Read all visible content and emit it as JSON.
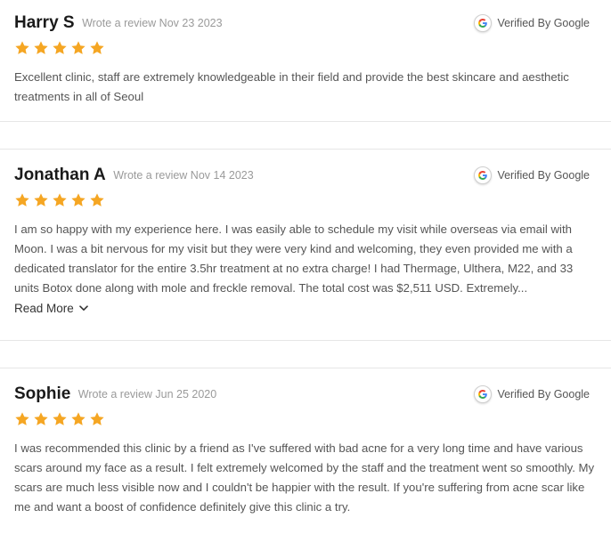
{
  "accent_star_color": "#f5a623",
  "icons": {
    "verified": "google-g-icon",
    "star": "star-icon",
    "read_more": "chevron-down-icon"
  },
  "reviews": [
    {
      "name": "Harry S",
      "meta": "Wrote a review Nov 23 2023",
      "verified_label": "Verified By",
      "verified_source": "Google",
      "rating": 5,
      "text": "Excellent clinic, staff are extremely knowledgeable in their field and provide the best skincare and aesthetic treatments in all of Seoul"
    },
    {
      "name": "Jonathan A",
      "meta": "Wrote a review Nov 14 2023",
      "verified_label": "Verified By",
      "verified_source": "Google",
      "rating": 5,
      "text": "I am so happy with my experience here. I was easily able to schedule my visit while overseas via email with Moon. I was a bit nervous for my visit but they were very kind and welcoming, they even provided me with a dedicated translator for the entire 3.5hr treatment at no extra charge! I had Thermage, Ulthera, M22, and 33 units Botox done along with mole and freckle removal. The total cost was $2,511 USD. Extremely...",
      "read_more": "Read More"
    },
    {
      "name": "Sophie",
      "meta": "Wrote a review Jun 25 2020",
      "verified_label": "Verified By",
      "verified_source": "Google",
      "rating": 5,
      "text": "I was recommended this clinic by a friend as I've suffered with bad acne for a very long time and have various scars around my face as a result. I felt extremely welcomed by the staff and the treatment went so smoothly. My scars are much less visible now and I couldn't be happier with the result. If you're suffering from acne scar like me and want a boost of confidence definitely give this clinic a try."
    }
  ]
}
